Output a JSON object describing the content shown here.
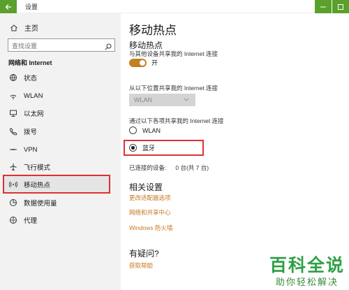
{
  "window": {
    "title": "设置"
  },
  "sidebar": {
    "home_label": "主页",
    "search_placeholder": "查找设置",
    "section_title": "网络和 Internet",
    "items": [
      {
        "label": "状态",
        "icon": "globe-icon"
      },
      {
        "label": "WLAN",
        "icon": "wifi-icon"
      },
      {
        "label": "以太网",
        "icon": "ethernet-icon"
      },
      {
        "label": "拨号",
        "icon": "phone-icon"
      },
      {
        "label": "VPN",
        "icon": "vpn-icon"
      },
      {
        "label": "飞行模式",
        "icon": "airplane-icon"
      },
      {
        "label": "移动热点",
        "icon": "hotspot-icon",
        "selected": true
      },
      {
        "label": "数据使用量",
        "icon": "data-usage-icon"
      },
      {
        "label": "代理",
        "icon": "proxy-icon"
      }
    ]
  },
  "main": {
    "page_title": "移动热点",
    "section_title": "移动热点",
    "toggle_desc": "与其他设备共享我的 Internet 连接",
    "toggle_state": "开",
    "share_from_label": "从以下位置共享我的 Internet 连接",
    "share_from_value": "WLAN",
    "share_to_label": "通过以下各项共享我的 Internet 连接",
    "radio_options": [
      {
        "label": "WLAN",
        "checked": false
      },
      {
        "label": "蓝牙",
        "checked": true
      }
    ],
    "connected_label": "已连接的设备:",
    "connected_value": "0 台(共 7 台)",
    "related_title": "相关设置",
    "related_links": [
      "更改适配器选项",
      "网络和共享中心",
      "Windows 防火墙"
    ],
    "question_title": "有疑问?",
    "help_link": "获取帮助"
  },
  "watermark": {
    "title": "百科全说",
    "subtitle": "助你轻松解决"
  },
  "colors": {
    "accent": "#c0811e",
    "link": "#c7761d",
    "titlebar_button": "#5aa02c",
    "highlight": "#e03030"
  }
}
